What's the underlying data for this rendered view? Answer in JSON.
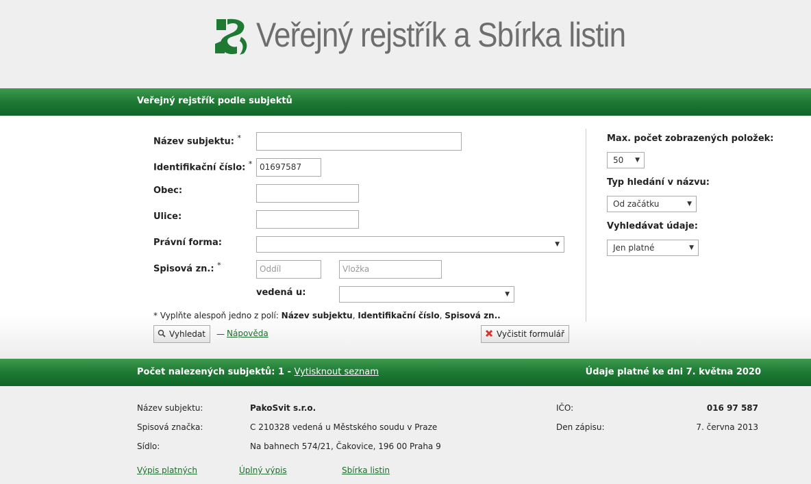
{
  "header": {
    "title": "Veřejný rejstřík a Sbírka listin"
  },
  "search_bar": {
    "title": "Veřejný rejstřík podle subjektů"
  },
  "form": {
    "name_label": "Název subjektu:",
    "name_value": "",
    "ico_label": "Identifikační číslo:",
    "ico_value": "01697587",
    "city_label": "Obec:",
    "city_value": "",
    "street_label": "Ulice:",
    "street_value": "",
    "legal_form_label": "Právní forma:",
    "legal_form_value": "",
    "file_no_label": "Spisová zn.:",
    "section_placeholder": "Oddíl",
    "insert_placeholder": "Vložka",
    "court_label": "vedená u:",
    "court_value": "",
    "required_mark": "*",
    "hint_prefix": "* Vyplňte alespoň jedno z polí: ",
    "hint_field1": "Název subjektu",
    "hint_sep1": ", ",
    "hint_field2": "Identifikační číslo",
    "hint_sep2": ", ",
    "hint_field3": "Spisová zn.",
    "hint_suffix": ".",
    "search_button": "Vyhledat",
    "dash": "—",
    "help_link": "Nápověda",
    "clear_button": "Vyčistit formulář"
  },
  "options": {
    "max_items_label": "Max. počet zobrazených položek:",
    "max_items_value": "50",
    "search_type_label": "Typ hledání v názvu:",
    "search_type_value": "Od začátku",
    "data_label": "Vyhledávat údaje:",
    "data_value": "Jen platné"
  },
  "results_bar": {
    "count_label": "Počet nalezených subjektů: 1",
    "separator": " - ",
    "print_link": "Vytisknout seznam",
    "valid_as_of": "Údaje platné ke dni 7. května 2020"
  },
  "result": {
    "name_label": "Název subjektu:",
    "name_value": "PakoSvit s.r.o.",
    "file_label": "Spisová značka:",
    "file_value": "C 210328 vedená u Městského soudu v Praze",
    "seat_label": "Sídlo:",
    "seat_value": "Na bahnech 574/21, Čakovice, 196 00 Praha 9",
    "ico_label": "IČO:",
    "ico_value": "016 97 587",
    "reg_date_label": "Den zápisu:",
    "reg_date_value": "7. června 2013",
    "links": [
      "Výpis platných",
      "Úplný výpis",
      "Sbírka listin"
    ]
  },
  "colors": {
    "brand_green": "#1e7a33",
    "link_green": "#1f6b2d",
    "logo_text": "#6e6e6e"
  },
  "icons": {
    "logo": "registry-logo-icon",
    "search": "magnifier-icon",
    "clear": "red-x-icon",
    "dropdown": "triangle-down-icon"
  }
}
